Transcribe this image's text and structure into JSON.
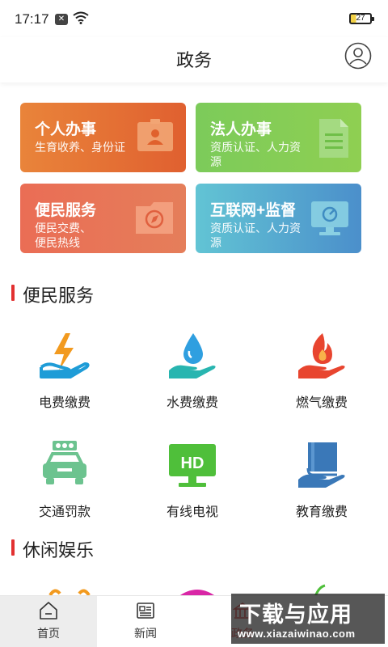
{
  "status_bar": {
    "time": "17:17",
    "battery": "27"
  },
  "header": {
    "title": "政务"
  },
  "cards": [
    {
      "title": "个人办事",
      "subtitle": "生育收养、身份证"
    },
    {
      "title": "法人办事",
      "subtitle": "资质认证、人力资源"
    },
    {
      "title": "便民服务",
      "subtitle": "便民交费、便民热线"
    },
    {
      "title": "互联网+监督",
      "subtitle": "资质认证、人力资源"
    }
  ],
  "sections": {
    "convenience": "便民服务",
    "leisure": "休闲娱乐"
  },
  "services": [
    {
      "label": "电费缴费",
      "icon": "electricity-icon"
    },
    {
      "label": "水费缴费",
      "icon": "water-icon"
    },
    {
      "label": "燃气缴费",
      "icon": "gas-icon"
    },
    {
      "label": "交通罚款",
      "icon": "car-icon"
    },
    {
      "label": "有线电视",
      "icon": "tv-icon"
    },
    {
      "label": "教育缴费",
      "icon": "book-icon"
    }
  ],
  "tabs": [
    {
      "label": "首页",
      "icon": "home-icon"
    },
    {
      "label": "新闻",
      "icon": "news-icon"
    },
    {
      "label": "政务",
      "icon": "government-icon"
    }
  ],
  "watermark": {
    "title": "下载与应用",
    "url": "www.xiazaiwinao.com"
  },
  "colors": {
    "accent": "#e23030",
    "orange": "#e9843a",
    "green": "#7ccb5a",
    "blue": "#4b8fcb"
  }
}
